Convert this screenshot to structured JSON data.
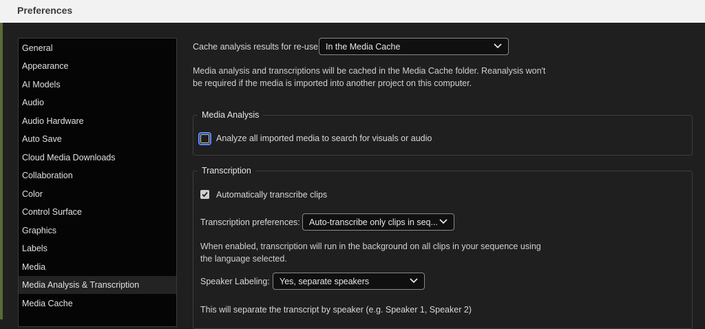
{
  "window": {
    "title": "Preferences"
  },
  "categories": [
    {
      "label": "General"
    },
    {
      "label": "Appearance"
    },
    {
      "label": "AI Models"
    },
    {
      "label": "Audio"
    },
    {
      "label": "Audio Hardware"
    },
    {
      "label": "Auto Save"
    },
    {
      "label": "Cloud Media Downloads"
    },
    {
      "label": "Collaboration"
    },
    {
      "label": "Color"
    },
    {
      "label": "Control Surface"
    },
    {
      "label": "Graphics"
    },
    {
      "label": "Labels"
    },
    {
      "label": "Media"
    },
    {
      "label": "Media Analysis & Transcription",
      "selected": true
    },
    {
      "label": "Media Cache"
    }
  ],
  "cache": {
    "label": "Cache analysis results for re-use:",
    "selected": "In the Media Cache",
    "description_line1": "Media analysis and transcriptions will be cached in the Media Cache folder. Reanalysis won't",
    "description_line2": "be required if the media is imported into another project on this computer."
  },
  "media_analysis": {
    "legend": "Media Analysis",
    "analyze_label": "Analyze all imported media to search for visuals or audio",
    "analyze_checked": false
  },
  "transcription": {
    "legend": "Transcription",
    "auto_label": "Automatically transcribe clips",
    "auto_checked": true,
    "prefs_label": "Transcription preferences:",
    "prefs_selected": "Auto-transcribe only clips in seq...",
    "enabled_line1": "When enabled, transcription will run in the background on all clips in your sequence using",
    "enabled_line2": "the language selected.",
    "speaker_label": "Speaker Labeling:",
    "speaker_selected": "Yes, separate speakers",
    "speaker_note": "This will separate the transcript by speaker (e.g. Speaker 1, Speaker 2)"
  }
}
